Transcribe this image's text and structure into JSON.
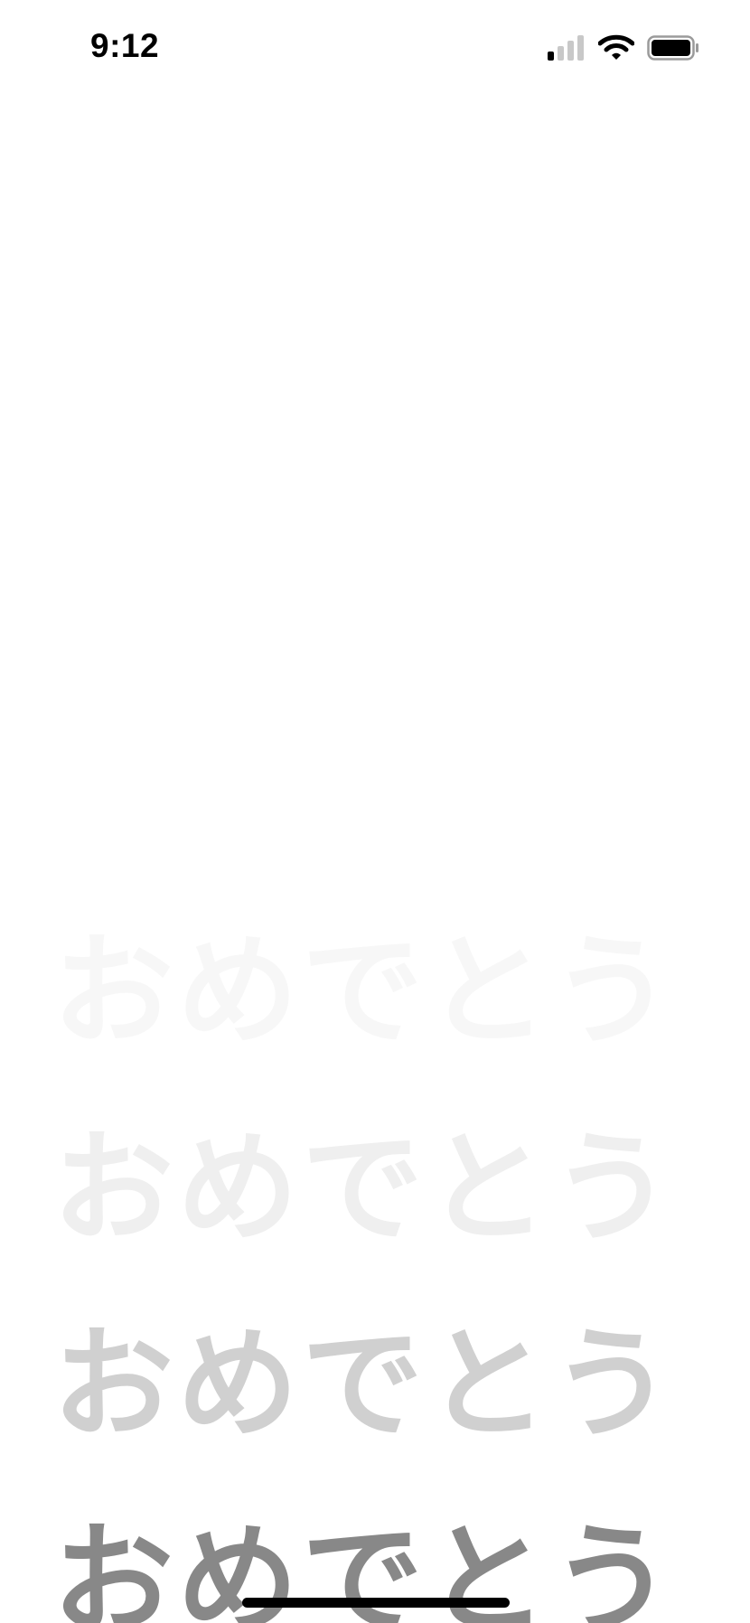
{
  "status_bar": {
    "time": "9:12",
    "signal_icon": "cellular-signal-icon",
    "wifi_icon": "wifi-icon",
    "battery_icon": "battery-icon"
  },
  "words": [
    {
      "text": "おめでとう",
      "color": "#f7f7f7"
    },
    {
      "text": "おめでとう",
      "color": "#efefef"
    },
    {
      "text": "おめでとう",
      "color": "#d0d0d0"
    },
    {
      "text": "おめでとう",
      "color": "#888888"
    }
  ],
  "colors": {
    "background": "#ffffff",
    "home_indicator": "#000000"
  }
}
